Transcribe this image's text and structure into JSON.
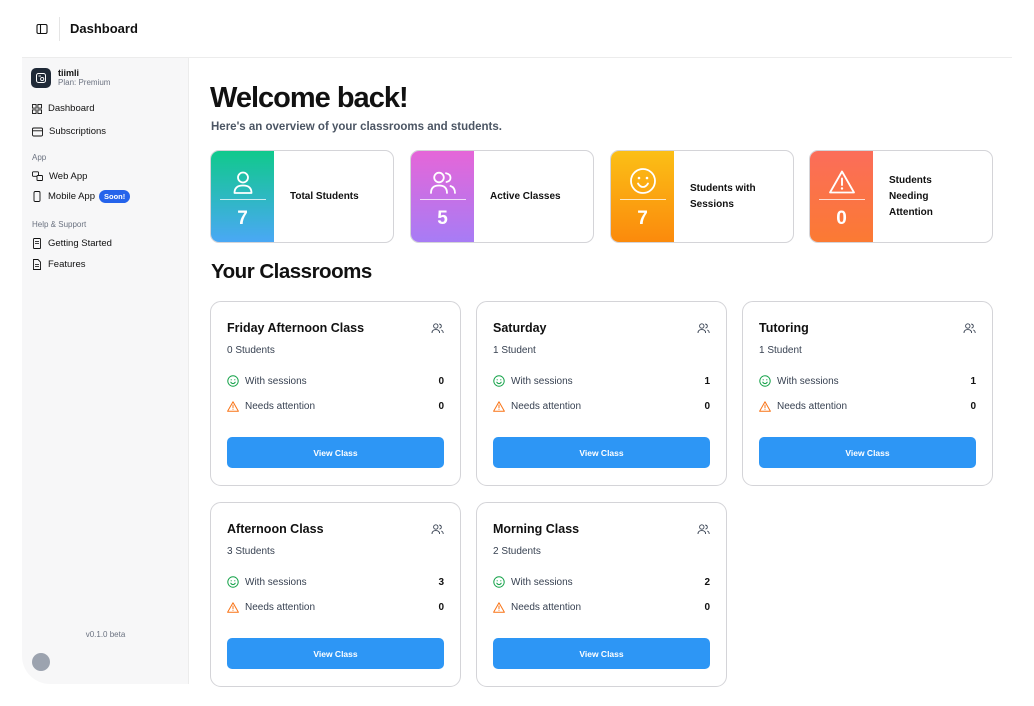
{
  "header": {
    "title": "Dashboard"
  },
  "sidebar": {
    "brand": {
      "name": "tiimli",
      "plan": "Plan: Premium"
    },
    "main_items": [
      {
        "label": "Dashboard",
        "icon": "grid-icon"
      },
      {
        "label": "Subscriptions",
        "icon": "credit-card-icon"
      }
    ],
    "app_section": {
      "label": "App",
      "items": [
        {
          "label": "Web App",
          "icon": "web-app-icon"
        },
        {
          "label": "Mobile App",
          "icon": "smartphone-icon",
          "badge": "Soon!"
        }
      ]
    },
    "help_section": {
      "label": "Help & Support",
      "items": [
        {
          "label": "Getting Started",
          "icon": "book-icon"
        },
        {
          "label": "Features",
          "icon": "document-icon"
        }
      ]
    },
    "version": "v0.1.0 beta"
  },
  "main": {
    "heading": "Welcome back!",
    "subheading": "Here's an overview of your classrooms and students.",
    "stats": [
      {
        "label": "Total Students",
        "value": "7",
        "icon": "user-icon",
        "gradient": [
          "#10c98c",
          "#4aa8f5"
        ]
      },
      {
        "label": "Active Classes",
        "value": "5",
        "icon": "users-icon",
        "gradient": [
          "#e566d8",
          "#a77cf5"
        ]
      },
      {
        "label": "Students with Sessions",
        "value": "7",
        "icon": "smile-icon",
        "gradient": [
          "#fbbf16",
          "#fb8a0c"
        ]
      },
      {
        "label": "Students Needing Attention",
        "value": "0",
        "icon": "alert-triangle-icon",
        "gradient": [
          "#fb6d5a",
          "#fb7a33"
        ]
      }
    ],
    "classrooms_title": "Your Classrooms",
    "classrooms": [
      {
        "name": "Friday Afternoon Class",
        "count": "0 Students",
        "sessions_label": "With sessions",
        "sessions": "0",
        "attention_label": "Needs attention",
        "attention": "0",
        "button": "View Class"
      },
      {
        "name": "Saturday",
        "count": "1 Student",
        "sessions_label": "With sessions",
        "sessions": "1",
        "attention_label": "Needs attention",
        "attention": "0",
        "button": "View Class"
      },
      {
        "name": "Tutoring",
        "count": "1 Student",
        "sessions_label": "With sessions",
        "sessions": "1",
        "attention_label": "Needs attention",
        "attention": "0",
        "button": "View Class"
      },
      {
        "name": "Afternoon Class",
        "count": "3 Students",
        "sessions_label": "With sessions",
        "sessions": "3",
        "attention_label": "Needs attention",
        "attention": "0",
        "button": "View Class"
      },
      {
        "name": "Morning Class",
        "count": "2 Students",
        "sessions_label": "With sessions",
        "sessions": "2",
        "attention_label": "Needs attention",
        "attention": "0",
        "button": "View Class"
      }
    ],
    "colors": {
      "accent": "#2d96f5",
      "success": "#16a34a",
      "warning": "#f97316"
    }
  }
}
